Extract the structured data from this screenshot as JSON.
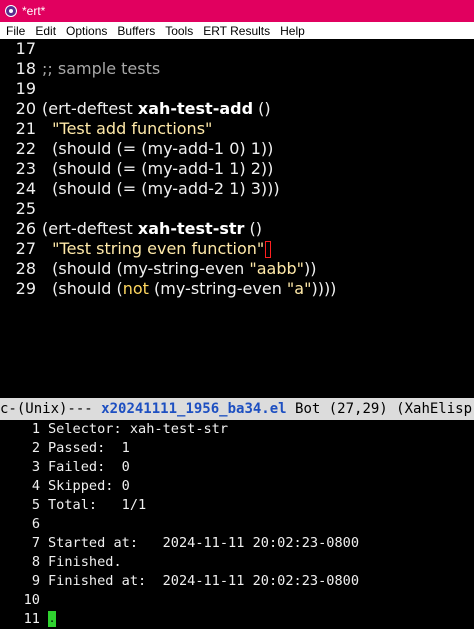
{
  "window": {
    "title": "*ert*"
  },
  "menu": [
    "File",
    "Edit",
    "Options",
    "Buffers",
    "Tools",
    "ERT Results",
    "Help"
  ],
  "editor": {
    "lines": [
      {
        "n": "17",
        "t": ""
      },
      {
        "n": "18",
        "t": ";; sample tests"
      },
      {
        "n": "19",
        "t": ""
      },
      {
        "n": "20",
        "a": "(ert-deftest ",
        "b": "xah-test-add",
        "c": " ()"
      },
      {
        "n": "21",
        "t": "\"Test add functions\""
      },
      {
        "n": "22",
        "t": "(should (= (my-add-1 0) 1))"
      },
      {
        "n": "23",
        "t": "(should (= (my-add-1 1) 2))"
      },
      {
        "n": "24",
        "t": "(should (= (my-add-2 1) 3)))"
      },
      {
        "n": "25",
        "t": ""
      },
      {
        "n": "26",
        "a": "(ert-deftest ",
        "b": "xah-test-str",
        "c": " ()"
      },
      {
        "n": "27",
        "t": "\"Test string even function\""
      },
      {
        "n": "28",
        "a": "(should (my-string-even ",
        "s": "\"aabb\"",
        "c": "))"
      },
      {
        "n": "29",
        "a": "(should (",
        "k": "not",
        "m": " (my-string-even ",
        "s": "\"a\"",
        "c": "))))"
      }
    ]
  },
  "modeline": {
    "prefix": "c-(Unix)--- ",
    "filename": "x20241111_1956_ba34.el",
    "rest": " Bot (27,29) (XahElisp"
  },
  "results": {
    "lines": [
      {
        "n": "1",
        "t": "Selector: xah-test-str"
      },
      {
        "n": "2",
        "t": "Passed:  1"
      },
      {
        "n": "3",
        "t": "Failed:  0"
      },
      {
        "n": "4",
        "t": "Skipped: 0"
      },
      {
        "n": "5",
        "t": "Total:   1/1"
      },
      {
        "n": "6",
        "t": ""
      },
      {
        "n": "7",
        "t": "Started at:   2024-11-11 20:02:23-0800"
      },
      {
        "n": "8",
        "t": "Finished."
      },
      {
        "n": "9",
        "t": "Finished at:  2024-11-11 20:02:23-0800"
      },
      {
        "n": "10",
        "t": ""
      },
      {
        "n": "11",
        "t": "."
      }
    ]
  }
}
